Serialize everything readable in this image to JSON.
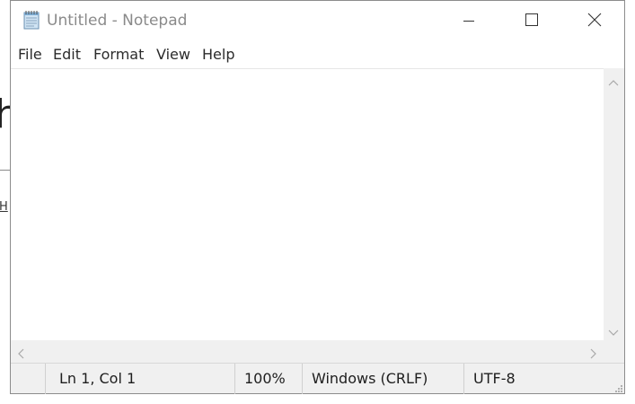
{
  "window": {
    "title": "Untitled - Notepad",
    "title_color": "#8a8a8a"
  },
  "titlebar": {
    "app_icon": "notepad-icon",
    "minimize_icon": "minimize-icon",
    "maximize_icon": "maximize-icon",
    "close_icon": "close-icon"
  },
  "menu": {
    "items": [
      {
        "label": "File"
      },
      {
        "label": "Edit"
      },
      {
        "label": "Format"
      },
      {
        "label": "View"
      },
      {
        "label": "Help"
      }
    ]
  },
  "editor": {
    "content": ""
  },
  "status": {
    "position": "Ln 1, Col 1",
    "zoom": "100%",
    "line_ending": "Windows (CRLF)",
    "encoding": "UTF-8"
  },
  "colors": {
    "statusbar_bg": "#f0f0f0",
    "scrollbar_bg": "#f0f0f0",
    "window_border": "#8c8c8c",
    "background_accent": "#b8361e"
  }
}
